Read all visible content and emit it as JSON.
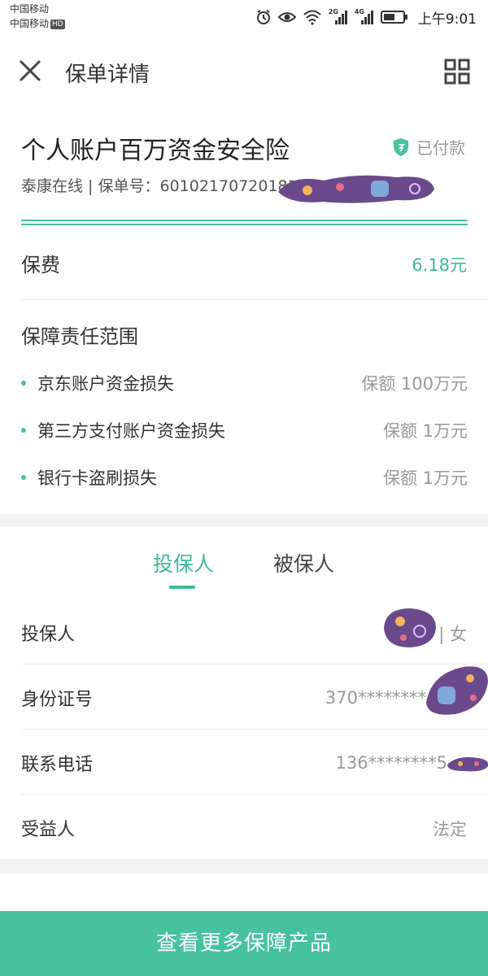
{
  "status_bar": {
    "carrier1": "中国移动",
    "carrier2": "中国移动",
    "carrier2_badge": "HD",
    "network1": "2G",
    "network2": "4G",
    "time": "上午9:01"
  },
  "header": {
    "title": "保单详情",
    "close_icon": "close-icon",
    "menu_icon": "grid-icon"
  },
  "policy": {
    "name": "个人账户百万资金安全险",
    "status": "已付款",
    "subtitle": "泰康在线 | 保单号：601021707201815",
    "premium_label": "保费",
    "premium_value": "6.18元"
  },
  "coverage": {
    "title": "保障责任范围",
    "items": [
      {
        "name": "京东账户资金损失",
        "amount": "保额 100万元"
      },
      {
        "name": "第三方支付账户资金损失",
        "amount": "保额 1万元"
      },
      {
        "name": "银行卡盗刷损失",
        "amount": "保额 1万元"
      }
    ]
  },
  "tabs": [
    {
      "label": "投保人",
      "active": true
    },
    {
      "label": "被保人",
      "active": false
    }
  ],
  "applicant": {
    "rows": [
      {
        "label": "投保人",
        "value": "| 女"
      },
      {
        "label": "身份证号",
        "value": "370********"
      },
      {
        "label": "联系电话",
        "value": "136********5"
      },
      {
        "label": "受益人",
        "value": "法定"
      }
    ]
  },
  "footer": {
    "button_label": "查看更多保障产品"
  },
  "colors": {
    "accent": "#47c29d",
    "divider": "#ececec"
  }
}
